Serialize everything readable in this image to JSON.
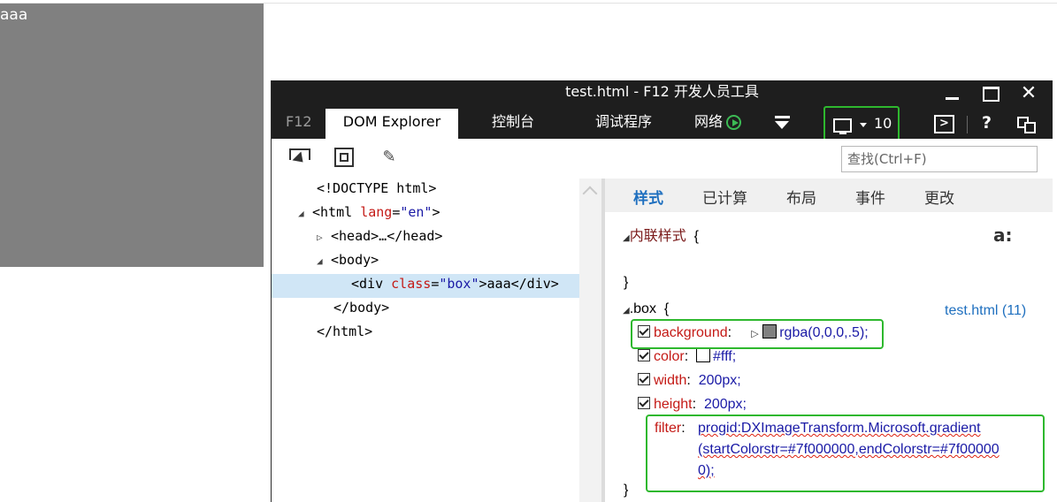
{
  "page": {
    "box_text": "aaa"
  },
  "devtools": {
    "title": "test.html - F12 开发人员工具",
    "tabs": {
      "f12": "F12",
      "dom": "DOM Explorer",
      "console": "控制台",
      "debugger": "调试程序",
      "network": "网络"
    },
    "emulation_version": "10",
    "help": "?",
    "close": "✕",
    "find_placeholder": "查找(Ctrl+F)"
  },
  "dom_tree": {
    "doctype": "<!DOCTYPE html>",
    "html_open_tag": "html",
    "html_attr": "lang",
    "html_attr_value": "\"en\"",
    "head": "<head>…</head>",
    "body_open": "<body>",
    "div_tag": "div",
    "div_attr": "class",
    "div_attr_value": "\"box\"",
    "div_text": "aaa",
    "div_close": "</div>",
    "body_close": "</body>",
    "html_close": "</html>"
  },
  "styles": {
    "subtabs": [
      "样式",
      "已计算",
      "布局",
      "事件",
      "更改"
    ],
    "inline_selector": "内联样式",
    "open_brace": "{",
    "close_brace": "}",
    "a_icon": "a:",
    "rule_selector": ".box",
    "rule_source": "test.html (11)",
    "declarations": [
      {
        "prop": "background",
        "value": "rgba(0,0,0,.5);",
        "swatch": "#808080"
      },
      {
        "prop": "color",
        "value": "#fff;",
        "swatch": "#ffffff"
      },
      {
        "prop": "width",
        "value": "200px;"
      },
      {
        "prop": "height",
        "value": "200px;"
      }
    ],
    "filter": {
      "prop": "filter",
      "line1": "progid:DXImageTransform.Microsoft.gradient",
      "line2": "(startColorstr=#7f000000,endColorstr=#7f00000",
      "line3": "0);"
    }
  },
  "colors": {
    "highlight": "#2eb82e",
    "accent": "#1e6fbf",
    "titlebar": "#1e1e1e"
  }
}
